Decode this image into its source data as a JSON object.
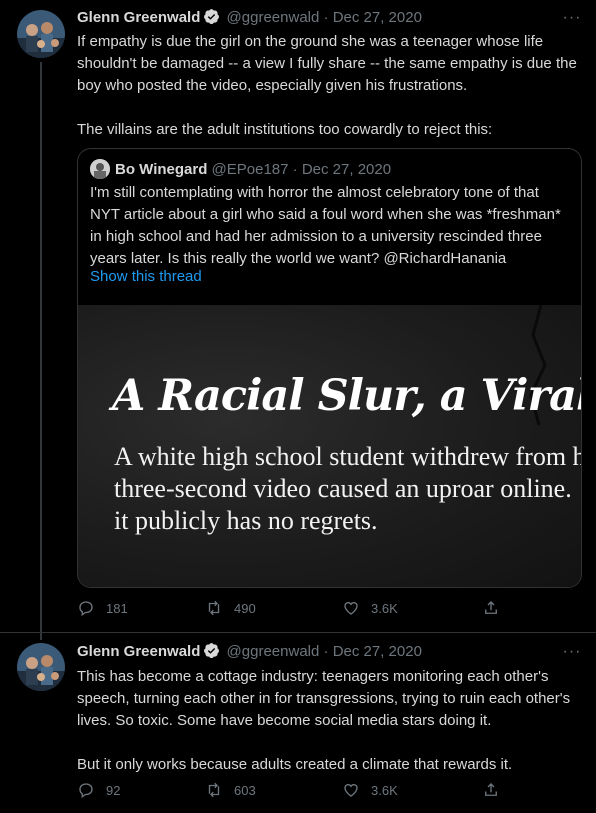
{
  "tweets": [
    {
      "author_name": "Glenn Greenwald",
      "handle": "@ggreenwald",
      "separator": "·",
      "date": "Dec 27, 2020",
      "more": "···",
      "paragraphs": [
        "If empathy is due the girl on the ground she was a teenager whose life shouldn't be damaged -- a view I fully share -- the same empathy is due the boy who posted the video, especially given his frustrations.",
        "The villains are the adult institutions too cowardly to reject this:"
      ],
      "quote": {
        "author_name": "Bo Winegard",
        "handle": "@EPoe187",
        "separator": "·",
        "date": "Dec 27, 2020",
        "text": "I'm still contemplating with horror the almost celebratory tone of that NYT article about a girl who said a foul word when she was *freshman* in high school and had her admission to a university rescinded three years later. Is this really the world we want? @RichardHanania",
        "show_thread": "Show this thread",
        "image": {
          "headline": "A Racial Slur, a Viral",
          "sub_lines": [
            "A white high school student withdrew from h",
            "three-second video caused an uproar online.",
            "it publicly has no regrets."
          ]
        }
      },
      "replies": "181",
      "retweets": "490",
      "likes": "3.6K"
    },
    {
      "author_name": "Glenn Greenwald",
      "handle": "@ggreenwald",
      "separator": "·",
      "date": "Dec 27, 2020",
      "more": "···",
      "paragraphs": [
        "This has become a cottage industry: teenagers monitoring each other's speech, turning each other in for transgressions, trying to ruin each other's lives. So toxic. Some have become social media stars doing it.",
        "But it only works because adults created a climate that rewards it."
      ],
      "replies": "92",
      "retweets": "603",
      "likes": "3.6K"
    }
  ],
  "colors": {
    "background": "#000000",
    "text": "#d9d9d9",
    "muted": "#6e767d",
    "link": "#1d9bf0",
    "verified": "#d9d9d9",
    "border": "#2f3336"
  },
  "icons": {
    "verified": "verified-badge-icon",
    "reply": "reply-icon",
    "retweet": "retweet-icon",
    "like": "heart-icon",
    "share": "share-icon",
    "more": "more-dots-icon"
  }
}
